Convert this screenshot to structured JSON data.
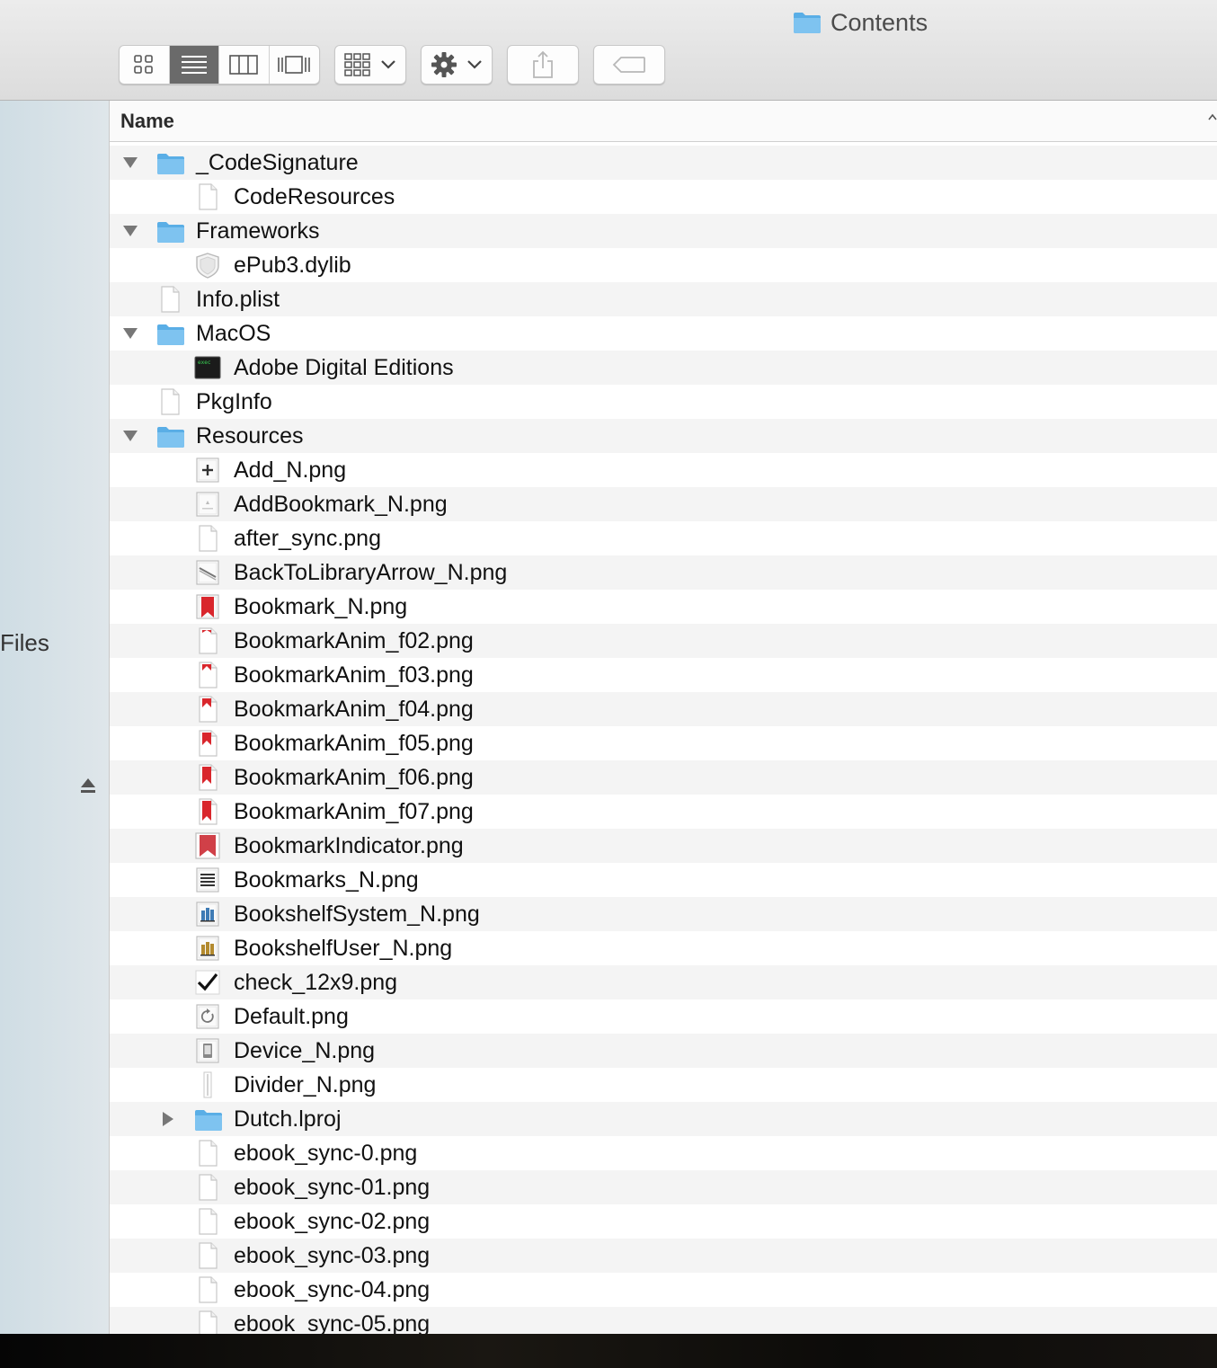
{
  "window": {
    "title": "Contents"
  },
  "toolbar": {
    "view_modes": [
      "icon-view",
      "list-view",
      "column-view",
      "cover-flow-view"
    ],
    "active_view": "list-view"
  },
  "sidebar": {
    "label": "Files"
  },
  "columns": {
    "name": "Name"
  },
  "rows": [
    {
      "label": "_CodeSignature",
      "icon": "folder-icon",
      "disclosure": "expanded",
      "depth": 0
    },
    {
      "label": "CodeResources",
      "icon": "document-icon",
      "disclosure": "none",
      "depth": 1
    },
    {
      "label": "Frameworks",
      "icon": "folder-icon",
      "disclosure": "expanded",
      "depth": 0
    },
    {
      "label": "ePub3.dylib",
      "icon": "dylib-icon",
      "disclosure": "none",
      "depth": 1
    },
    {
      "label": "Info.plist",
      "icon": "document-icon",
      "disclosure": "none",
      "depth": 0
    },
    {
      "label": "MacOS",
      "icon": "folder-icon",
      "disclosure": "expanded",
      "depth": 0
    },
    {
      "label": "Adobe Digital Editions",
      "icon": "terminal-executable-icon",
      "disclosure": "none",
      "depth": 1
    },
    {
      "label": "PkgInfo",
      "icon": "document-icon",
      "disclosure": "none",
      "depth": 0
    },
    {
      "label": "Resources",
      "icon": "folder-icon",
      "disclosure": "expanded",
      "depth": 0
    },
    {
      "label": "Add_N.png",
      "icon": "plus-image-icon",
      "disclosure": "none",
      "depth": 1
    },
    {
      "label": "AddBookmark_N.png",
      "icon": "image-thumb-icon",
      "disclosure": "none",
      "depth": 1
    },
    {
      "label": "after_sync.png",
      "icon": "blank-image-icon",
      "disclosure": "none",
      "depth": 1
    },
    {
      "label": "BackToLibraryArrow_N.png",
      "icon": "arrow-image-icon",
      "disclosure": "none",
      "depth": 1
    },
    {
      "label": "Bookmark_N.png",
      "icon": "red-bookmark-icon",
      "disclosure": "none",
      "depth": 1
    },
    {
      "label": "BookmarkAnim_f02.png",
      "icon": "bookmark-anim-icon",
      "disclosure": "none",
      "depth": 1,
      "level": 0.15
    },
    {
      "label": "BookmarkAnim_f03.png",
      "icon": "bookmark-anim-icon",
      "disclosure": "none",
      "depth": 1,
      "level": 0.3
    },
    {
      "label": "BookmarkAnim_f04.png",
      "icon": "bookmark-anim-icon",
      "disclosure": "none",
      "depth": 1,
      "level": 0.45
    },
    {
      "label": "BookmarkAnim_f05.png",
      "icon": "bookmark-anim-icon",
      "disclosure": "none",
      "depth": 1,
      "level": 0.65
    },
    {
      "label": "BookmarkAnim_f06.png",
      "icon": "bookmark-anim-icon",
      "disclosure": "none",
      "depth": 1,
      "level": 0.85
    },
    {
      "label": "BookmarkAnim_f07.png",
      "icon": "bookmark-anim-icon",
      "disclosure": "none",
      "depth": 1,
      "level": 1.0
    },
    {
      "label": "BookmarkIndicator.png",
      "icon": "bookmark-indicator-icon",
      "disclosure": "none",
      "depth": 1
    },
    {
      "label": "Bookmarks_N.png",
      "icon": "list-image-icon",
      "disclosure": "none",
      "depth": 1
    },
    {
      "label": "BookshelfSystem_N.png",
      "icon": "bookshelf-blue-icon",
      "disclosure": "none",
      "depth": 1
    },
    {
      "label": "BookshelfUser_N.png",
      "icon": "bookshelf-gold-icon",
      "disclosure": "none",
      "depth": 1
    },
    {
      "label": "check_12x9.png",
      "icon": "check-icon",
      "disclosure": "none",
      "depth": 1
    },
    {
      "label": "Default.png",
      "icon": "refresh-image-icon",
      "disclosure": "none",
      "depth": 1
    },
    {
      "label": "Device_N.png",
      "icon": "device-image-icon",
      "disclosure": "none",
      "depth": 1
    },
    {
      "label": "Divider_N.png",
      "icon": "divider-image-icon",
      "disclosure": "none",
      "depth": 1
    },
    {
      "label": "Dutch.lproj",
      "icon": "folder-icon",
      "disclosure": "collapsed",
      "depth": 1
    },
    {
      "label": "ebook_sync-0.png",
      "icon": "blank-image-icon",
      "disclosure": "none",
      "depth": 1
    },
    {
      "label": "ebook_sync-01.png",
      "icon": "blank-image-icon",
      "disclosure": "none",
      "depth": 1
    },
    {
      "label": "ebook_sync-02.png",
      "icon": "blank-image-icon",
      "disclosure": "none",
      "depth": 1
    },
    {
      "label": "ebook_sync-03.png",
      "icon": "blank-image-icon",
      "disclosure": "none",
      "depth": 1
    },
    {
      "label": "ebook_sync-04.png",
      "icon": "blank-image-icon",
      "disclosure": "none",
      "depth": 1
    },
    {
      "label": "ebook_sync-05.png",
      "icon": "blank-image-icon",
      "disclosure": "none",
      "depth": 1
    }
  ],
  "colors": {
    "folder": "#7ec3f0",
    "folder_dark": "#5aaee6",
    "bookmark_red": "#d9262c",
    "sidebar_bg": "#d6e1e7",
    "row_alt": "#f4f4f4"
  }
}
